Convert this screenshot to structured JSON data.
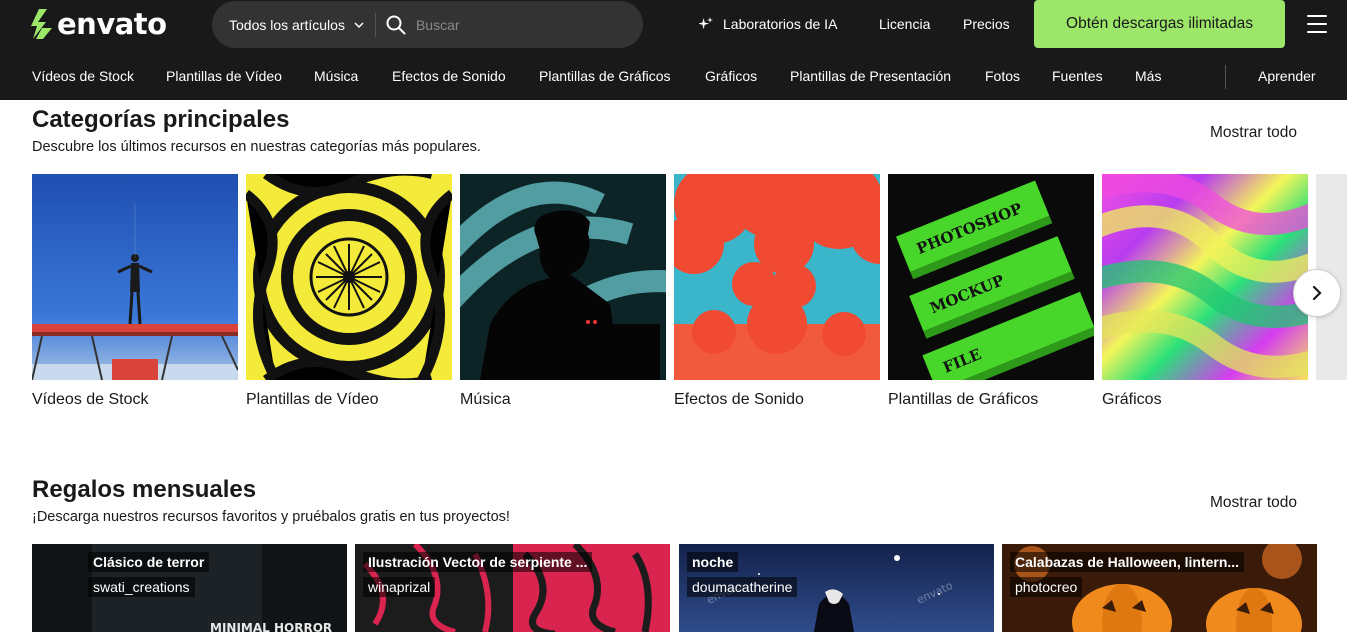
{
  "brand": {
    "name": "envato",
    "accent": "#9ce66a",
    "bg": "#191919"
  },
  "header": {
    "search": {
      "category": "Todos los artículos",
      "placeholder": "Buscar"
    },
    "ai_lab": "Laboratorios de IA",
    "license": "Licencia",
    "prices": "Precios",
    "cta": "Obtén descargas ilimitadas"
  },
  "nav": {
    "items": [
      "Vídeos de Stock",
      "Plantillas de Vídeo",
      "Música",
      "Efectos de Sonido",
      "Plantillas de Gráficos",
      "Gráficos",
      "Plantillas de Presentación",
      "Fotos",
      "Fuentes",
      "Más"
    ],
    "learn": "Aprender"
  },
  "categories": {
    "title": "Categorías principales",
    "subtitle": "Descubre los últimos recursos en nuestras categorías más populares.",
    "show_all": "Mostrar todo",
    "items": [
      {
        "label": "Vídeos de Stock"
      },
      {
        "label": "Plantillas de Vídeo"
      },
      {
        "label": "Música"
      },
      {
        "label": "Efectos de Sonido"
      },
      {
        "label": "Plantillas de Gráficos"
      },
      {
        "label": "Gráficos"
      }
    ],
    "mockup_texts": [
      "PHOTOSHOP",
      "MOCKUP",
      "FILE"
    ]
  },
  "gifts": {
    "title": "Regalos mensuales",
    "subtitle": "¡Descarga nuestros recursos favoritos y pruébalos gratis en tus proyectos!",
    "show_all": "Mostrar todo",
    "items": [
      {
        "title": "Clásico de terror",
        "author": "swati_creations",
        "overlay": "MINIMAL HORROR"
      },
      {
        "title": "Ilustración Vector de serpiente ...",
        "author": "winaprizal"
      },
      {
        "title": "noche",
        "author": "doumacatherine",
        "watermark": "envato"
      },
      {
        "title": "Calabazas de Halloween, lintern...",
        "author": "photocreo"
      }
    ]
  }
}
